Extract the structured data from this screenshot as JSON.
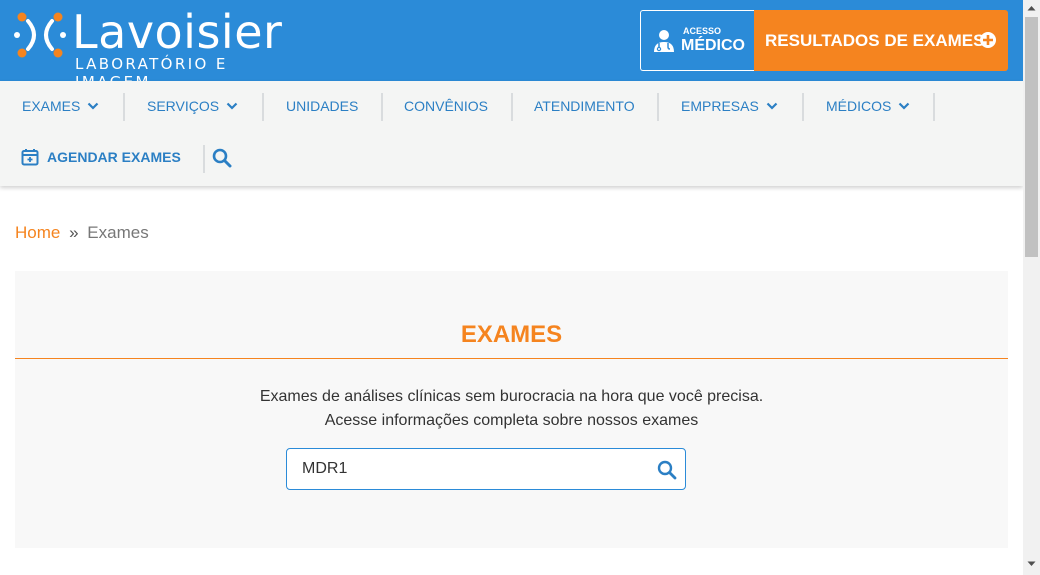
{
  "header": {
    "brand": "Lavoisier",
    "tagline": "LABORATÓRIO E IMAGEM",
    "acesso_small": "ACESSO",
    "acesso_big": "MÉDICO",
    "resultados_label": "RESULTADOS DE EXAMES",
    "colors": {
      "primary": "#2b8bd8",
      "accent": "#f5841f"
    }
  },
  "nav": {
    "items": [
      {
        "label": "EXAMES",
        "has_dropdown": true
      },
      {
        "label": "SERVIÇOS",
        "has_dropdown": true
      },
      {
        "label": "UNIDADES",
        "has_dropdown": false
      },
      {
        "label": "CONVÊNIOS",
        "has_dropdown": false
      },
      {
        "label": "ATENDIMENTO",
        "has_dropdown": false
      },
      {
        "label": "EMPRESAS",
        "has_dropdown": true
      },
      {
        "label": "MÉDICOS",
        "has_dropdown": true
      }
    ],
    "agendar_label": "AGENDAR EXAMES",
    "icons": {
      "agendar": "calendar-plus-icon",
      "search": "search-icon",
      "chevron": "chevron-down-icon"
    }
  },
  "breadcrumb": {
    "home": "Home",
    "separator": "»",
    "current": "Exames"
  },
  "main": {
    "title": "EXAMES",
    "desc_line1": "Exames de análises clínicas sem burocracia na hora que você precisa.",
    "desc_line2": "Acesse informações completa sobre nossos exames",
    "search_value": "MDR1"
  }
}
